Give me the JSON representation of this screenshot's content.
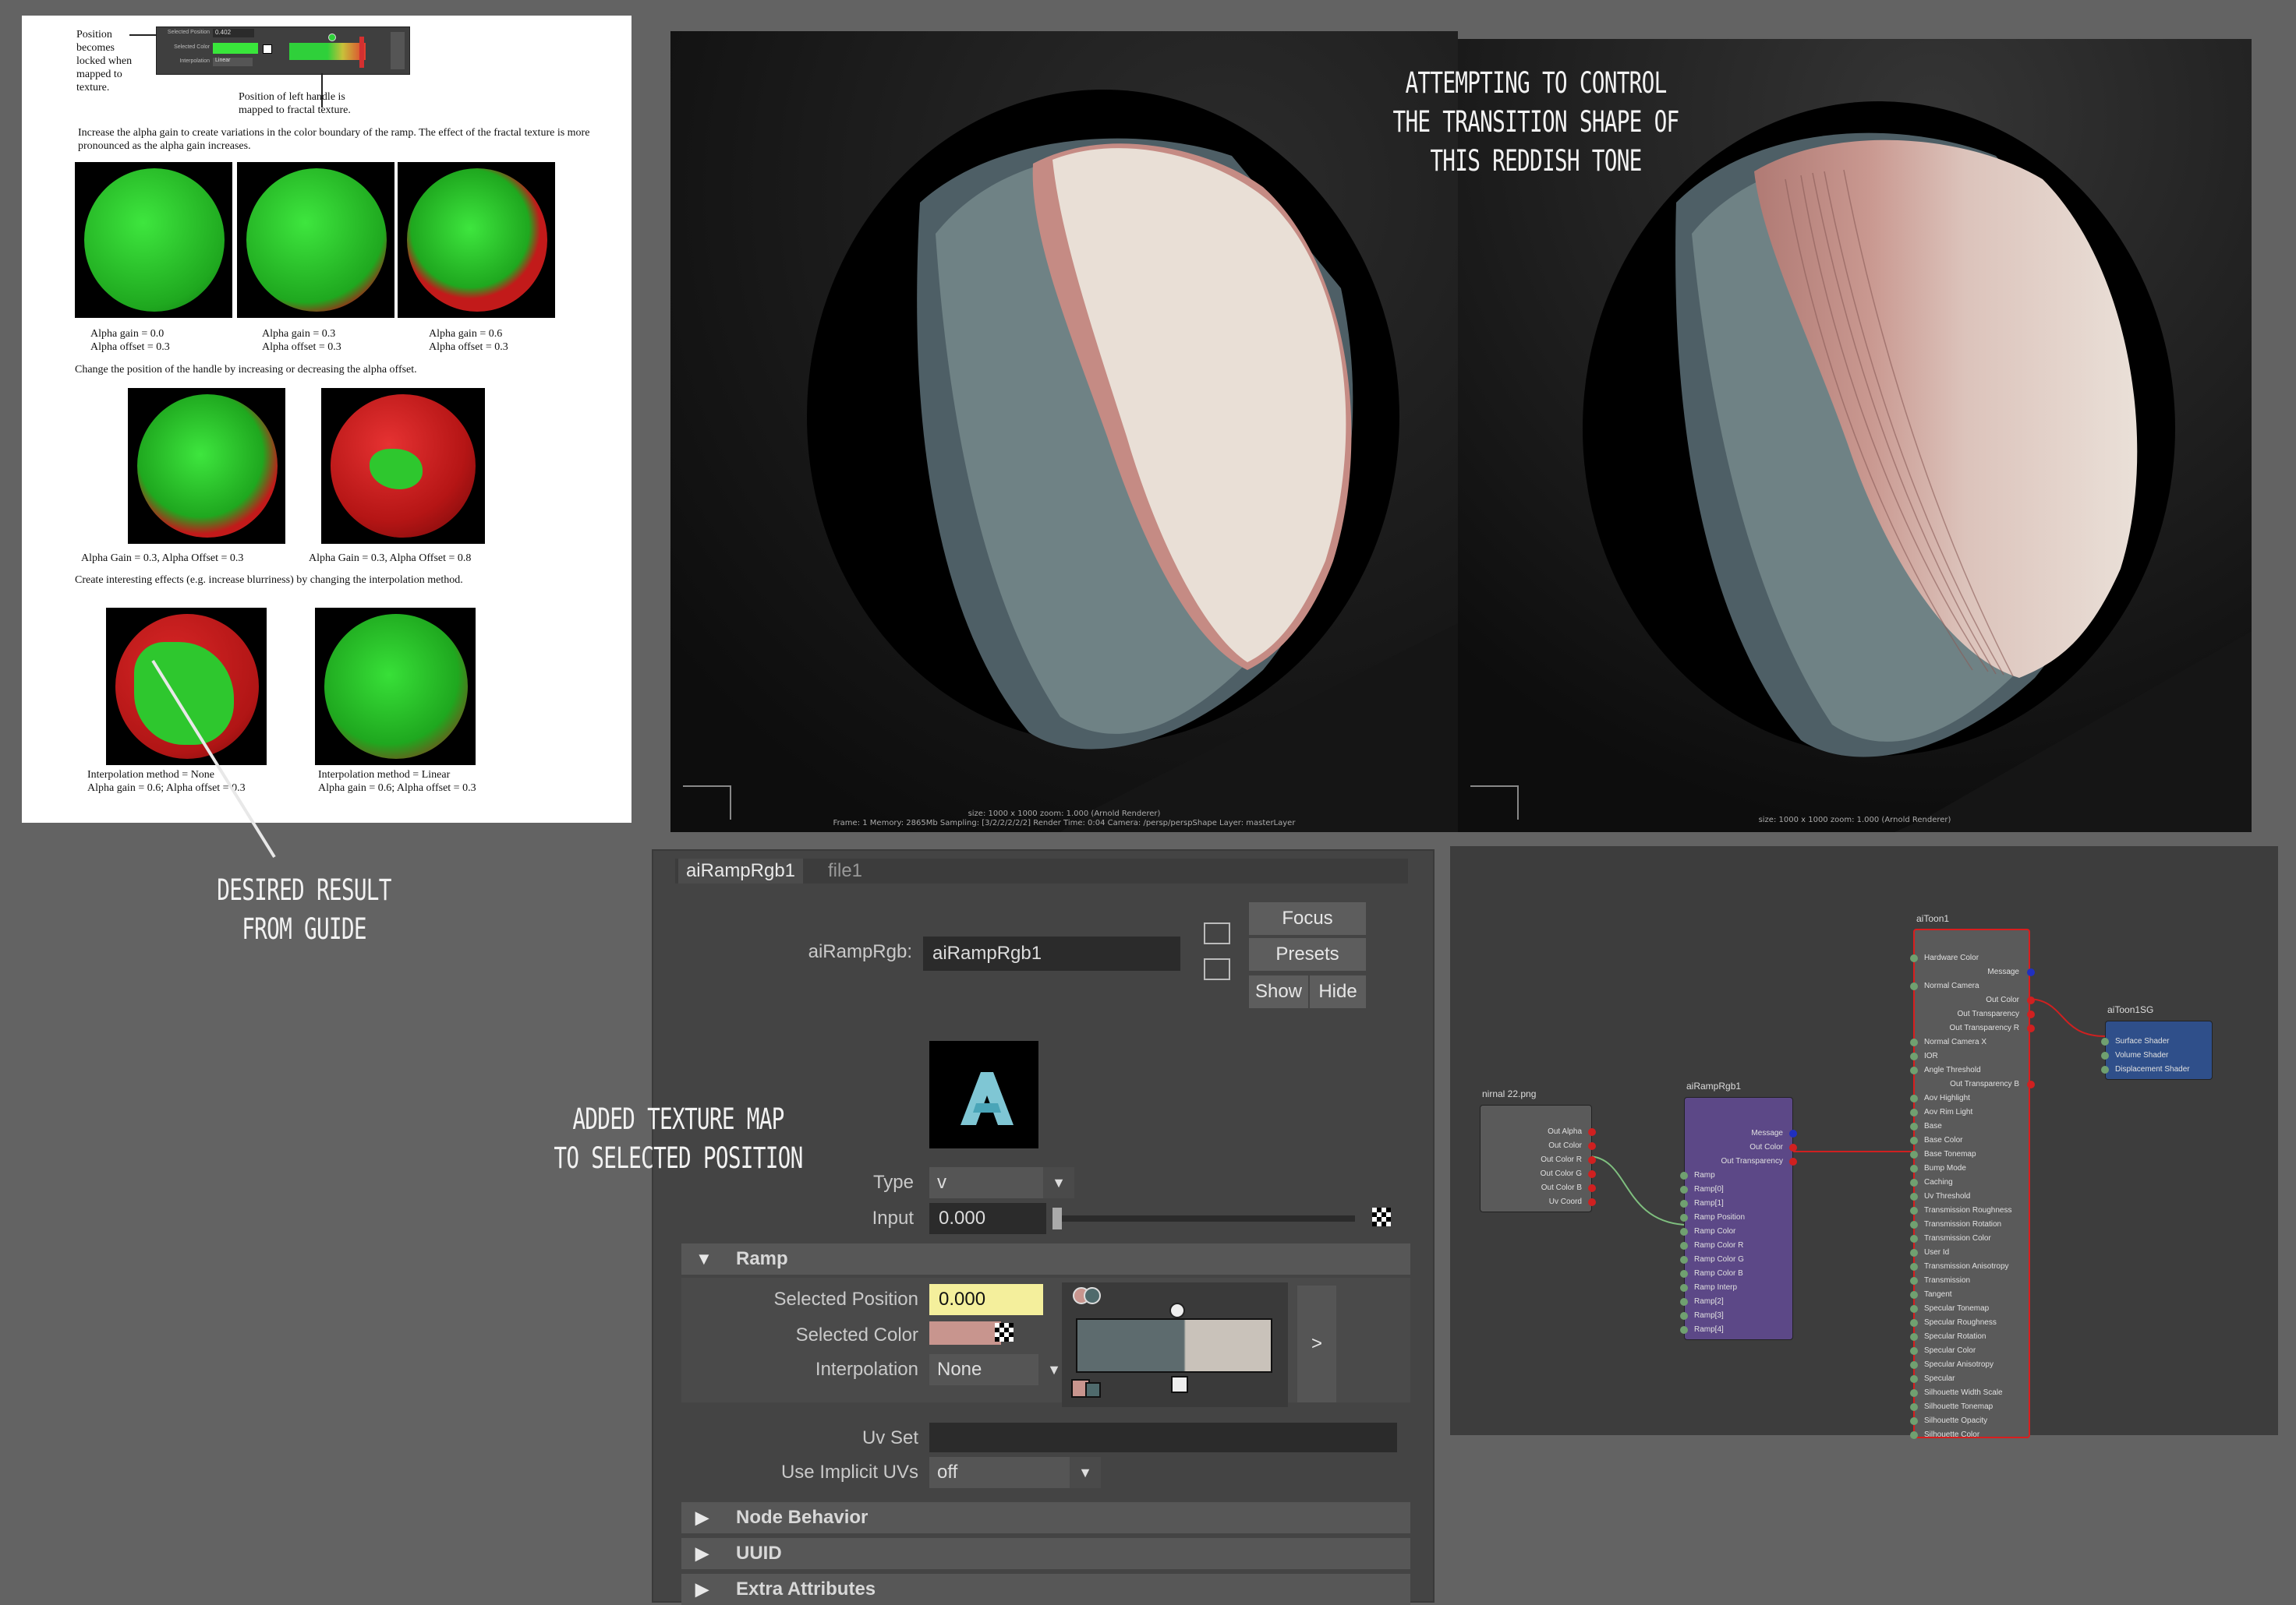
{
  "guide": {
    "callout_left": [
      "Position",
      "becomes",
      "locked when",
      "mapped to",
      "texture."
    ],
    "ramp_row1_label": "Selected Position",
    "ramp_row1_value": "0.402",
    "ramp_row2_label": "Selected Color",
    "ramp_row3_label": "Interpolation",
    "ramp_row3_value": "Linear",
    "callout_bottom": [
      "Position of left handle is",
      "mapped to fractal texture."
    ],
    "para1": "Increase the alpha gain to create variations in the color boundary of the ramp. The effect of the fractal texture is more pronounced as the alpha gain increases.",
    "row1_captions": [
      [
        "Alpha gain = 0.0",
        "Alpha offset = 0.3"
      ],
      [
        "Alpha gain = 0.3",
        "Alpha offset = 0.3"
      ],
      [
        "Alpha gain = 0.6",
        "Alpha offset = 0.3"
      ]
    ],
    "para2": "Change the position of the handle by increasing or decreasing the alpha offset.",
    "row2_captions": [
      "Alpha Gain = 0.3, Alpha Offset = 0.3",
      "Alpha Gain = 0.3, Alpha Offset = 0.8"
    ],
    "para3": "Create interesting effects (e.g. increase blurriness) by changing the interpolation method.",
    "row3_captions": [
      [
        "Interpolation method = None",
        "Alpha gain = 0.6; Alpha offset = 0.3"
      ],
      [
        "Interpolation method = Linear",
        "Alpha gain = 0.6; Alpha offset = 0.3"
      ]
    ]
  },
  "annotations": {
    "desired": [
      "DESIRED RESULT",
      "FROM GUIDE"
    ],
    "attempting": [
      "ATTEMPTING TO CONTROL",
      "THE TRANSITION SHAPE OF",
      "THIS REDDISH TONE"
    ],
    "added": [
      "ADDED TEXTURE MAP",
      "TO SELECTED POSITION"
    ]
  },
  "renders": {
    "left_status1": "size: 1000 x 1000  zoom: 1.000     (Arnold Renderer)",
    "left_status2": "Frame: 1    Memory: 2865Mb    Sampling: [3/2/2/2/2/2]    Render Time: 0:04    Camera: /persp/perspShape    Layer: masterLayer",
    "right_status1": "size: 1000 x 1000  zoom: 1.000     (Arnold Renderer)"
  },
  "attribute_editor": {
    "tabs": [
      "aiRampRgb1",
      "file1"
    ],
    "node_label": "aiRampRgb:",
    "node_name": "aiRampRgb1",
    "buttons": {
      "focus": "Focus",
      "presets": "Presets",
      "show": "Show",
      "hide": "Hide"
    },
    "type_label": "Type",
    "type_value": "v",
    "input_label": "Input",
    "input_value": "0.000",
    "ramp_section": "Ramp",
    "selected_position_label": "Selected Position",
    "selected_position_value": "0.000",
    "selected_color_label": "Selected Color",
    "selected_color": "#c8958e",
    "interpolation_label": "Interpolation",
    "interpolation_value": "None",
    "ramp_expand": ">",
    "uv_set_label": "Uv Set",
    "use_implicit_label": "Use Implicit UVs",
    "use_implicit_value": "off",
    "sections": [
      "Node Behavior",
      "UUID",
      "Extra Attributes"
    ],
    "ramp_colors": [
      "#5d6b6e",
      "#c9c2ba"
    ]
  },
  "node_editor": {
    "file_node": {
      "title": "nirnal 22.png",
      "ports": [
        "Out Alpha",
        "Out Color",
        "Out Color R",
        "Out Color G",
        "Out Color B",
        "Uv Coord"
      ]
    },
    "ramp_node": {
      "title": "aiRampRgb1",
      "ports": [
        "Message",
        "Out Color",
        "Out Transparency",
        "Ramp",
        "Ramp[0]",
        "Ramp[1]",
        "Ramp Position",
        "Ramp Color",
        "Ramp Color R",
        "Ramp Color G",
        "Ramp Color B",
        "Ramp Interp",
        "Ramp[2]",
        "Ramp[3]",
        "Ramp[4]"
      ]
    },
    "toon_node": {
      "title": "aiToon1",
      "ports": [
        "Hardware Color",
        "Message",
        "Normal Camera",
        "Out Color",
        "Out Transparency",
        "Out Transparency R",
        "Normal Camera X",
        "IOR",
        "Angle Threshold",
        "Out Transparency B",
        "Aov Highlight",
        "Aov Rim Light",
        "Base",
        "Base Color",
        "Base Tonemap",
        "Bump Mode",
        "Caching",
        "Uv Threshold",
        "Transmission Roughness",
        "Transmission Rotation",
        "Transmission Color",
        "User Id",
        "Transmission Anisotropy",
        "Transmission",
        "Tangent",
        "Specular Tonemap",
        "Specular Roughness",
        "Specular Rotation",
        "Specular Color",
        "Specular Anisotropy",
        "Specular",
        "Silhouette Width Scale",
        "Silhouette Tonemap",
        "Silhouette Opacity",
        "Silhouette Color"
      ]
    },
    "sg_node": {
      "title": "aiToon1SG",
      "ports": [
        "Surface Shader",
        "Volume Shader",
        "Displacement Shader"
      ]
    }
  }
}
